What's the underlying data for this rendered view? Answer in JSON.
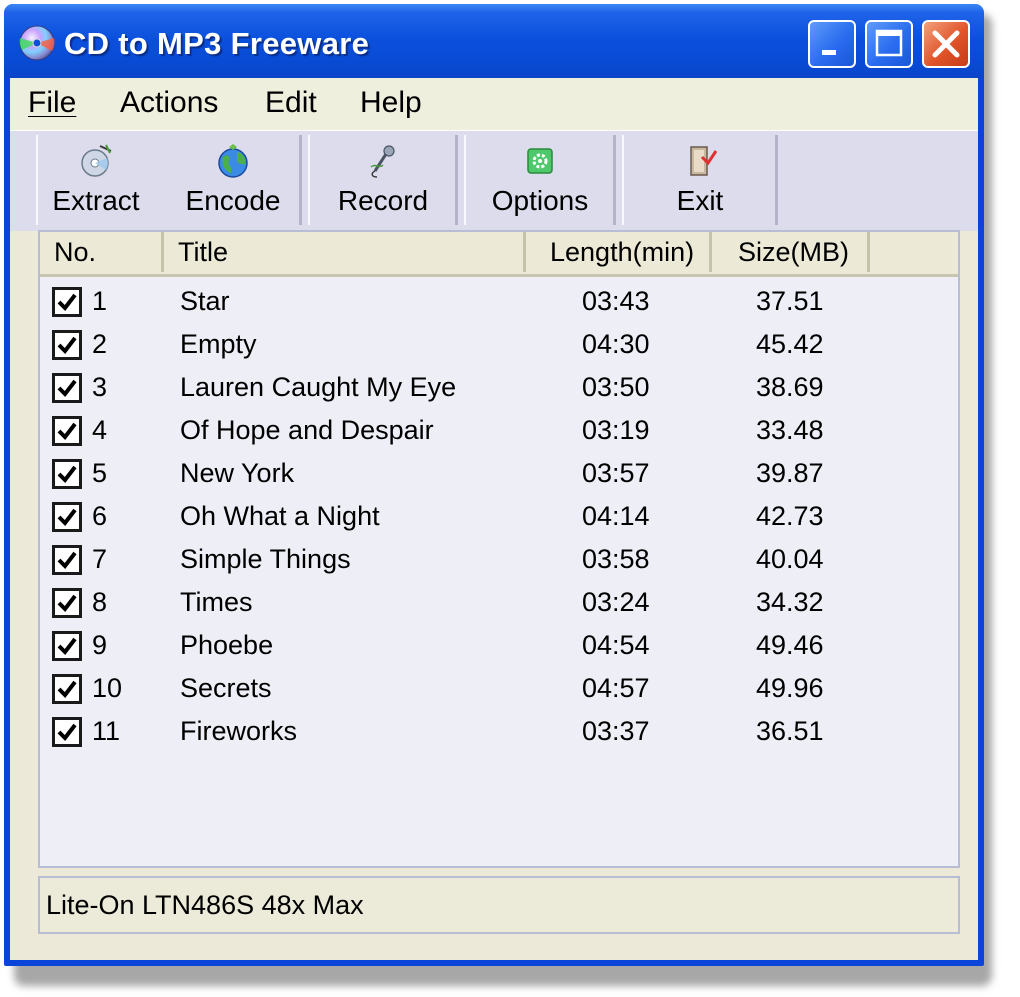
{
  "window": {
    "title": "CD to MP3 Freeware"
  },
  "menu": [
    {
      "label": "File"
    },
    {
      "label": "Actions"
    },
    {
      "label": "Edit"
    },
    {
      "label": "Help"
    }
  ],
  "toolbar": {
    "extract_label": "Extract",
    "encode_label": "Encode",
    "record_label": "Record",
    "options_label": "Options",
    "exit_label": "Exit"
  },
  "table": {
    "columns": [
      "No.",
      "Title",
      "Length(min)",
      "Size(MB)"
    ],
    "rows": [
      {
        "checked": true,
        "no": "1",
        "title": "Star",
        "length": "03:43",
        "size": "37.51"
      },
      {
        "checked": true,
        "no": "2",
        "title": "Empty",
        "length": "04:30",
        "size": "45.42"
      },
      {
        "checked": true,
        "no": "3",
        "title": "Lauren Caught My Eye",
        "length": "03:50",
        "size": "38.69"
      },
      {
        "checked": true,
        "no": "4",
        "title": "Of Hope and Despair",
        "length": "03:19",
        "size": "33.48"
      },
      {
        "checked": true,
        "no": "5",
        "title": "New York",
        "length": "03:57",
        "size": "39.87"
      },
      {
        "checked": true,
        "no": "6",
        "title": "Oh What a Night",
        "length": "04:14",
        "size": "42.73"
      },
      {
        "checked": true,
        "no": "7",
        "title": "Simple Things",
        "length": "03:58",
        "size": "40.04"
      },
      {
        "checked": true,
        "no": "8",
        "title": "Times",
        "length": "03:24",
        "size": "34.32"
      },
      {
        "checked": true,
        "no": "9",
        "title": "Phoebe",
        "length": "04:54",
        "size": "49.46"
      },
      {
        "checked": true,
        "no": "10",
        "title": "Secrets",
        "length": "04:57",
        "size": "49.96"
      },
      {
        "checked": true,
        "no": "11",
        "title": "Fireworks",
        "length": "03:37",
        "size": "36.51"
      }
    ]
  },
  "status": {
    "drive": "Lite-On LTN486S 48x Max"
  },
  "icons": {
    "app": "cd-disc-icon",
    "extract": "cd-extract-icon",
    "encode": "globe-icon",
    "record": "microphone-icon",
    "options": "gear-icon",
    "exit": "door-exit-icon"
  },
  "colors": {
    "titlebar": "#0a4fdc",
    "close_button": "#e2542a",
    "window_bg": "#ece9d8",
    "list_bg": "#eeeef6"
  }
}
